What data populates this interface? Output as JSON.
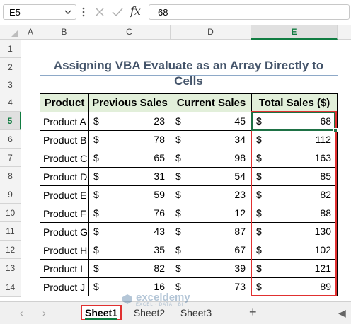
{
  "formula_bar": {
    "name_box": "E5",
    "fx_label": "fx",
    "value": "68"
  },
  "columns": [
    "A",
    "B",
    "C",
    "D",
    "E"
  ],
  "rows": [
    "1",
    "2",
    "3",
    "4",
    "5",
    "6",
    "7",
    "8",
    "9",
    "10",
    "11",
    "12",
    "13",
    "14"
  ],
  "title": "Assigning VBA Evaluate as an Array Directly to Cells",
  "table": {
    "headers": [
      "Product",
      "Previous Sales",
      "Current Sales",
      "Total Sales ($)"
    ],
    "currency_symbol": "$",
    "rows": [
      {
        "product": "Product A",
        "prev": "23",
        "curr": "45",
        "total": "68"
      },
      {
        "product": "Product B",
        "prev": "78",
        "curr": "34",
        "total": "112"
      },
      {
        "product": "Product C",
        "prev": "65",
        "curr": "98",
        "total": "163"
      },
      {
        "product": "Product D",
        "prev": "31",
        "curr": "54",
        "total": "85"
      },
      {
        "product": "Product E",
        "prev": "59",
        "curr": "23",
        "total": "82"
      },
      {
        "product": "Product F",
        "prev": "76",
        "curr": "12",
        "total": "88"
      },
      {
        "product": "Product G",
        "prev": "43",
        "curr": "87",
        "total": "130"
      },
      {
        "product": "Product H",
        "prev": "35",
        "curr": "67",
        "total": "102"
      },
      {
        "product": "Product I",
        "prev": "82",
        "curr": "39",
        "total": "121"
      },
      {
        "product": "Product J",
        "prev": "16",
        "curr": "73",
        "total": "89"
      }
    ]
  },
  "sheet_tabs": {
    "tabs": [
      "Sheet1",
      "Sheet2",
      "Sheet3"
    ],
    "add_label": "+"
  },
  "watermark": {
    "brand": "exceldemy",
    "tagline": "EXCEL · DATA · BI"
  },
  "colors": {
    "accent": "#107c41",
    "header_fill": "#e2efda",
    "highlight": "#e03030",
    "title_text": "#44546a"
  }
}
